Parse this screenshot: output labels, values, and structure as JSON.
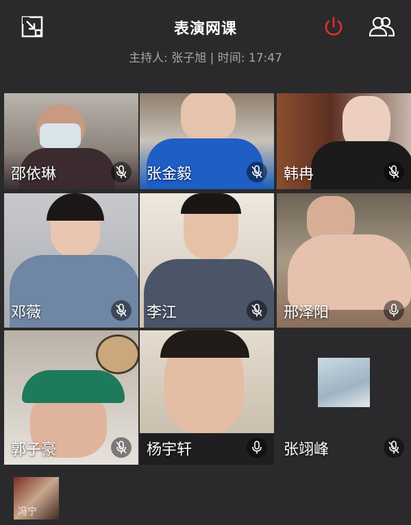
{
  "header": {
    "title": "表演网课",
    "subtitle": "主持人: 张子旭 | 时间: 17:47"
  },
  "colors": {
    "background": "#2a2a2c",
    "power_icon": "#e2302a",
    "muted_mic_bg": "#00000073"
  },
  "participants": [
    {
      "name": "邵依琳",
      "mic": "muted"
    },
    {
      "name": "张金毅",
      "mic": "muted"
    },
    {
      "name": "韩冉",
      "mic": "muted"
    },
    {
      "name": "邓薇",
      "mic": "muted"
    },
    {
      "name": "李江",
      "mic": "muted"
    },
    {
      "name": "邢泽阳",
      "mic": "on"
    },
    {
      "name": "郭子豪",
      "mic": "muted"
    },
    {
      "name": "杨宇轩",
      "mic": "on"
    },
    {
      "name": "张翊峰",
      "mic": "muted"
    }
  ],
  "extra_participant": {
    "name": "冯宁"
  }
}
